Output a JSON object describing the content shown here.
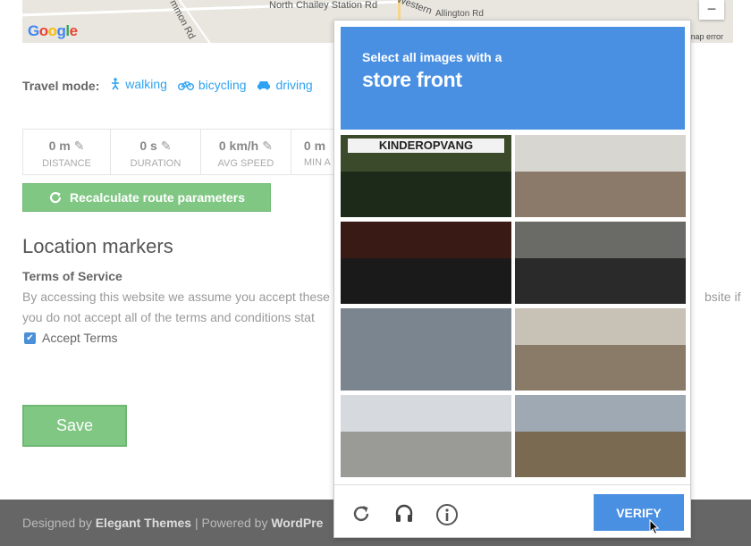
{
  "map": {
    "roads": [
      "North Chailey Station Rd",
      "Allington Rd",
      "Western",
      "mmon Rd"
    ],
    "logo": [
      "G",
      "o",
      "o",
      "g",
      "l",
      "e"
    ],
    "zoom_out": "−",
    "error_text": "map error"
  },
  "travel": {
    "label": "Travel mode:",
    "modes": [
      {
        "label": "walking",
        "icon": "walking-icon"
      },
      {
        "label": "bicycling",
        "icon": "bicycle-icon"
      },
      {
        "label": "driving",
        "icon": "car-icon"
      }
    ]
  },
  "stats": [
    {
      "value": "0 m",
      "label": "DISTANCE",
      "editable": true
    },
    {
      "value": "0 s",
      "label": "DURATION",
      "editable": true
    },
    {
      "value": "0 km/h",
      "label": "AVG SPEED",
      "editable": true
    },
    {
      "value": "0 m",
      "label": "MIN A",
      "editable": false
    }
  ],
  "recalculate_label": "Recalculate route parameters",
  "location_markers_heading": "Location markers",
  "terms": {
    "title": "Terms of Service",
    "line1": "By accessing this website we assume you accept these",
    "line2": "you do not accept all of the terms and conditions stat",
    "line1_tail": "bsite if",
    "accept_label": "Accept Terms",
    "accepted": true
  },
  "save_label": "Save",
  "footer": {
    "designed_prefix": "Designed by",
    "designer": "Elegant Themes",
    "separator": "| Powered by",
    "platform": "WordPre"
  },
  "captcha": {
    "subtitle": "Select all images with a",
    "target": "store front",
    "tiles": [
      {
        "name": "tile-kinderopvang",
        "sign": "KINDEROPVANG",
        "sky": "#3a4a2a",
        "ground": "#1d2a1a"
      },
      {
        "name": "tile-supermat",
        "sign": "",
        "sky": "#d8d6d0",
        "ground": "#8b7a6a"
      },
      {
        "name": "tile-cafe-night",
        "sign": "",
        "sky": "#3a1a14",
        "ground": "#1a1a1a"
      },
      {
        "name": "tile-shop-street",
        "sign": "",
        "sky": "#6a6a66",
        "ground": "#2a2a2a"
      },
      {
        "name": "tile-grey-wall",
        "sign": "",
        "sky": "#7b858f",
        "ground": "#7b858f"
      },
      {
        "name": "tile-house-brick",
        "sign": "",
        "sky": "#c8c2b6",
        "ground": "#8a7a68"
      },
      {
        "name": "tile-caravan",
        "sign": "",
        "sky": "#d6d9de",
        "ground": "#9a9a96"
      },
      {
        "name": "tile-house-hills",
        "sign": "",
        "sky": "#9fa9b3",
        "ground": "#7a6a52"
      }
    ],
    "verify_label": "VERIFY",
    "icons": [
      "reload-icon",
      "audio-icon",
      "info-icon"
    ]
  },
  "colors": {
    "link": "#2ea3f2",
    "green_button": "#81c784",
    "captcha_blue": "#4a90e2",
    "footer_bg": "#666666"
  }
}
